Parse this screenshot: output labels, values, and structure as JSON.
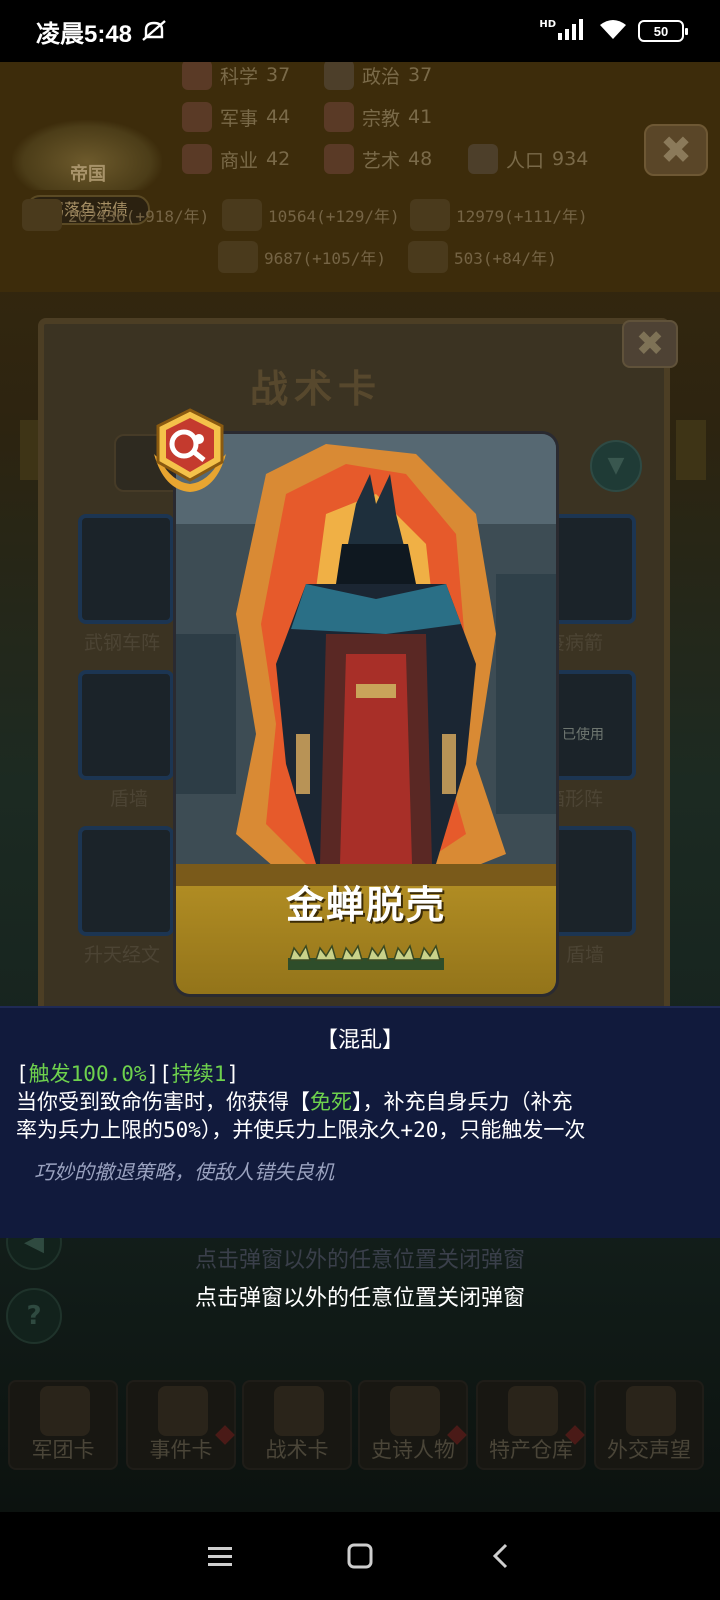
{
  "status_bar": {
    "time": "凌晨5:48",
    "network": "HD",
    "battery": "50"
  },
  "hud": {
    "empire_title": "帝国",
    "player_name": "羁落鱼涝债",
    "stats": [
      {
        "name": "科学",
        "value": "37"
      },
      {
        "name": "政治",
        "value": "37"
      },
      {
        "name": "军事",
        "value": "44"
      },
      {
        "name": "宗教",
        "value": "41"
      },
      {
        "name": "商业",
        "value": "42"
      },
      {
        "name": "艺术",
        "value": "48"
      },
      {
        "name": "人口",
        "value": "934"
      }
    ],
    "resources": [
      {
        "text": "202436(+918/年)"
      },
      {
        "text": "10564(+129/年)"
      },
      {
        "text": "12979(+111/年)"
      },
      {
        "text": "9687(+105/年)"
      },
      {
        "text": "503(+84/年)"
      }
    ],
    "close_glyph": "✖"
  },
  "panel": {
    "title": "战术卡",
    "close_glyph": "✖",
    "filter_glyph": "▼",
    "cards": [
      {
        "label": "武钢车阵"
      },
      {
        "label": "盾墙"
      },
      {
        "label": "升天经文"
      },
      {
        "label": "疫病箭"
      },
      {
        "label": "箱形阵",
        "status": "已使用"
      },
      {
        "label": "盾墙"
      }
    ]
  },
  "featured_card": {
    "name": "金蝉脱壳",
    "rarity_stars": 6,
    "effect_tag": "【混乱】",
    "trigger_prefix": "[",
    "trigger": "触发100.0%",
    "trigger_mid": "][",
    "duration": "持续1",
    "trigger_suffix": "]",
    "desc_line1_a": "当你受到致命伤害时，你获得【",
    "desc_keyword": "免死",
    "desc_line1_b": "】，补充自身兵力（补充",
    "desc_line2": "率为兵力上限的50%），并使兵力上限永久+20，只能触发一次",
    "flavor": "巧妙的撤退策略，使敌人错失良机"
  },
  "hints": {
    "ghost": "点击弹窗以外的任意位置关闭弹窗",
    "close_hint": "点击弹窗以外的任意位置关闭弹窗"
  },
  "side_controls": {
    "sound_glyph": "◀",
    "help_glyph": "?"
  },
  "bottom_tabs": [
    {
      "label": "军团卡"
    },
    {
      "label": "事件卡"
    },
    {
      "label": "战术卡"
    },
    {
      "label": "史诗人物"
    },
    {
      "label": "特产仓库"
    },
    {
      "label": "外交声望"
    }
  ],
  "colors": {
    "desc_bg": "#111a3c",
    "keyword_green": "#6ed24d",
    "card_gold": "#b08c23"
  }
}
